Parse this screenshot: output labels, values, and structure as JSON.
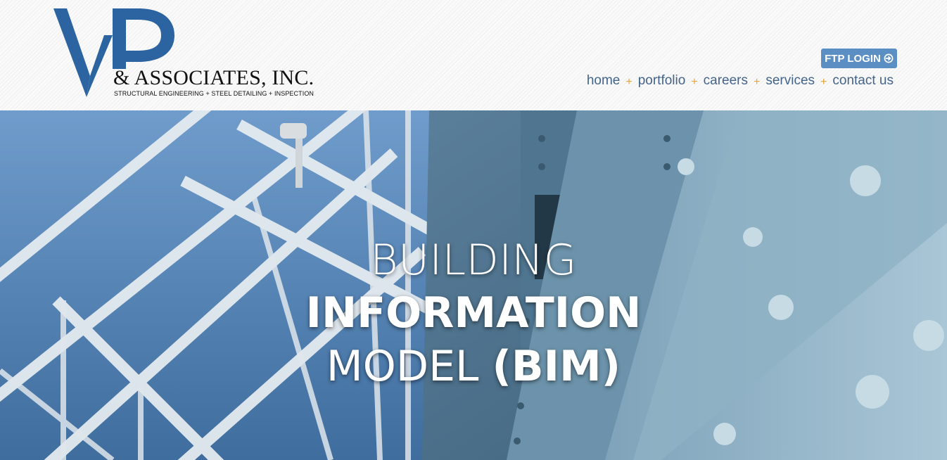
{
  "logo": {
    "monogram": "VP",
    "company": "& ASSOCIATES, INC.",
    "tagline": "STRUCTURAL ENGINEERING   +   STEEL DETAILING   +   INSPECTION",
    "brand_color": "#2b64a0"
  },
  "ftp": {
    "label": "FTP LOGIN",
    "icon": "login-icon"
  },
  "nav": {
    "separator": "+",
    "items": [
      {
        "label": "home"
      },
      {
        "label": "portfolio"
      },
      {
        "label": "careers"
      },
      {
        "label": "services"
      },
      {
        "label": "contact us"
      }
    ]
  },
  "hero": {
    "line1": "BUILDING",
    "line2": "INFORMATION",
    "line3_light": "MODEL",
    "line3_bold": "(BIM)"
  }
}
